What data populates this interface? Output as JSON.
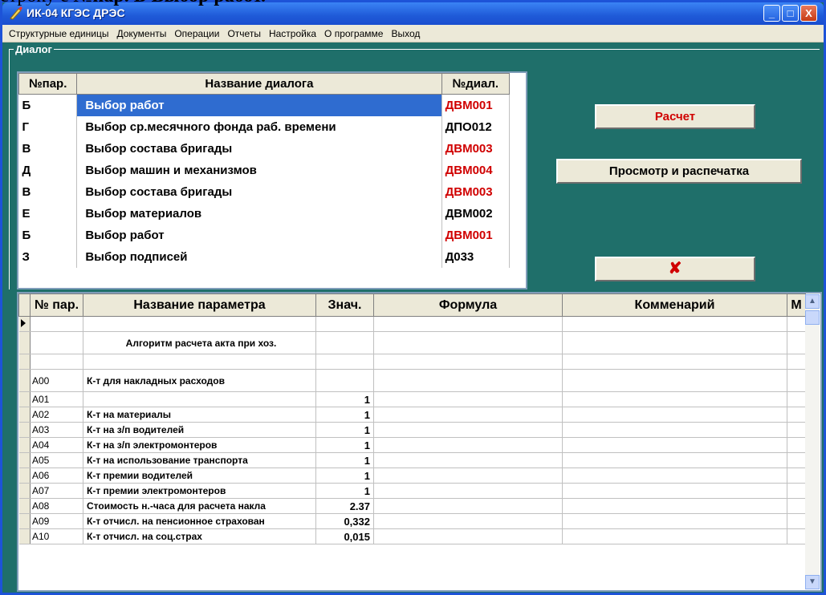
{
  "document_text": {
    "line": "строку с №пар. Б Выбор работ.",
    "normal": "строку с ",
    "bold": "№пар. Б Выбор работ."
  },
  "window": {
    "title": "ИК-04 КГЭС ДРЭС",
    "minimize": "_",
    "maximize": "□",
    "close": "X"
  },
  "menu": {
    "items": [
      "Структурные единицы",
      "Документы",
      "Операции",
      "Отчеты",
      "Настройка",
      "О программе",
      "Выход"
    ]
  },
  "dialog_group": {
    "label": "Диалог",
    "columns": [
      "№пар.",
      "Название диалога",
      "№диал."
    ],
    "rows": [
      {
        "par": "Б",
        "name": "Выбор работ",
        "code": "ДВМ001",
        "code_red": true,
        "selected": true
      },
      {
        "par": "Г",
        "name": "Выбор ср.месячного фонда раб. времени",
        "code": "ДПО012",
        "code_red": false,
        "selected": false
      },
      {
        "par": "В",
        "name": "Выбор состава бригады",
        "code": "ДВМ003",
        "code_red": true,
        "selected": false
      },
      {
        "par": "Д",
        "name": "Выбор машин и механизмов",
        "code": "ДВМ004",
        "code_red": true,
        "selected": false
      },
      {
        "par": "В",
        "name": "Выбор состава бригады",
        "code": "ДВМ003",
        "code_red": true,
        "selected": false
      },
      {
        "par": "Е",
        "name": "Выбор материалов",
        "code": "ДВМ002",
        "code_red": false,
        "selected": false
      },
      {
        "par": "Б",
        "name": "Выбор работ",
        "code": "ДВМ001",
        "code_red": true,
        "selected": false
      },
      {
        "par": "З",
        "name": "Выбор подписей",
        "code": "Д033",
        "code_red": false,
        "selected": false
      }
    ]
  },
  "buttons": {
    "calc": "Расчет",
    "print": "Просмотр и распечатка",
    "close": "✘"
  },
  "params": {
    "columns": [
      "№ пар.",
      "Название параметра",
      "Знач.",
      "Формула",
      "Комменарий",
      "М"
    ],
    "rows": [
      {
        "code": "",
        "name": "",
        "value": "",
        "current": true
      },
      {
        "code": "",
        "name": "Алгоритм расчета акта при хоз.",
        "value": "",
        "tall": true
      },
      {
        "code": "",
        "name": "",
        "value": ""
      },
      {
        "code": "A00",
        "name": "К-т для накладных расходов",
        "value": "",
        "tall": true
      },
      {
        "code": "A01",
        "name": "",
        "value": "1"
      },
      {
        "code": "A02",
        "name": "К-т на материалы",
        "value": "1"
      },
      {
        "code": "A03",
        "name": "К-т на з/п водителей",
        "value": "1"
      },
      {
        "code": "A04",
        "name": "К-т на з/п электромонтеров",
        "value": "1"
      },
      {
        "code": "A05",
        "name": "К-т на использование транспорта",
        "value": "1"
      },
      {
        "code": "A06",
        "name": "К-т премии водителей",
        "value": "1"
      },
      {
        "code": "A07",
        "name": "К-т премии электромонтеров",
        "value": "1"
      },
      {
        "code": "A08",
        "name": "Стоимость н.-часа для расчета накла",
        "value": "2.37"
      },
      {
        "code": "A09",
        "name": "К-т отчисл. на пенсионное страхован",
        "value": "0,332"
      },
      {
        "code": "A10",
        "name": "К-т отчисл. на соц.страх",
        "value": "0,015"
      }
    ]
  },
  "scrollbar": {
    "up": "▲",
    "down": "▼"
  },
  "colors": {
    "window_bg": "#1f6f6a",
    "title_blue": "#1f5ad8",
    "selection": "#2f6cd0",
    "red_text": "#d00000"
  }
}
